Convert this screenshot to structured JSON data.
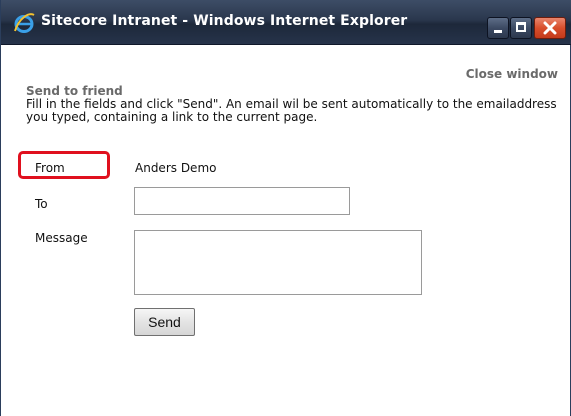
{
  "window": {
    "title": "Sitecore Intranet - Windows Internet Explorer",
    "app_icon": "internet-explorer-icon",
    "controls": {
      "minimize_icon": "minimize-icon",
      "maximize_icon": "maximize-icon",
      "close_icon": "close-icon",
      "close_color": "#d84e2c"
    }
  },
  "page": {
    "close_link": "Close window",
    "heading": "Send to friend",
    "description": "Fill in the fields and click \"Send\". An email wil be sent automatically to the emailaddress you typed, containing a link to the current page.",
    "form": {
      "from_label": "From",
      "from_value": "Anders Demo",
      "to_label": "To",
      "to_value": "",
      "message_label": "Message",
      "message_value": "",
      "send_label": "Send"
    },
    "highlight_color": "#e0101e"
  }
}
